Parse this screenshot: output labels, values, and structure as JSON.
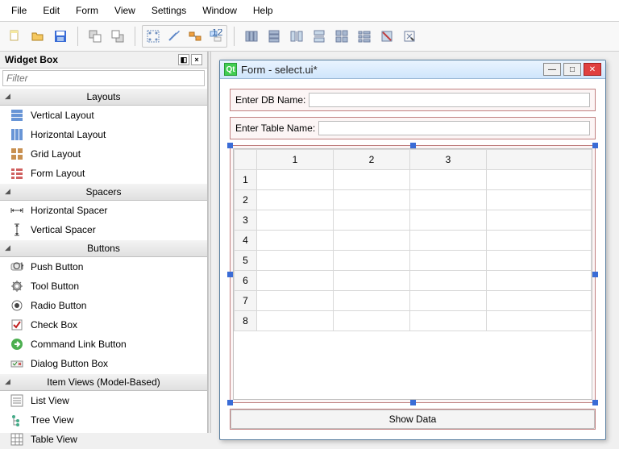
{
  "menu": [
    "File",
    "Edit",
    "Form",
    "View",
    "Settings",
    "Window",
    "Help"
  ],
  "widgetbox": {
    "title": "Widget Box",
    "filter_placeholder": "Filter",
    "categories": [
      {
        "name": "Layouts",
        "items": [
          "Vertical Layout",
          "Horizontal Layout",
          "Grid Layout",
          "Form Layout"
        ]
      },
      {
        "name": "Spacers",
        "items": [
          "Horizontal Spacer",
          "Vertical Spacer"
        ]
      },
      {
        "name": "Buttons",
        "items": [
          "Push Button",
          "Tool Button",
          "Radio Button",
          "Check Box",
          "Command Link Button",
          "Dialog Button Box"
        ]
      },
      {
        "name": "Item Views (Model-Based)",
        "items": [
          "List View",
          "Tree View",
          "Table View"
        ]
      }
    ]
  },
  "form": {
    "title": "Form - select.ui*",
    "db_label": "Enter DB Name:",
    "table_label": "Enter Table Name:",
    "col_headers": [
      "1",
      "2",
      "3"
    ],
    "row_headers": [
      "1",
      "2",
      "3",
      "4",
      "5",
      "6",
      "7",
      "8"
    ],
    "show_btn": "Show Data"
  }
}
